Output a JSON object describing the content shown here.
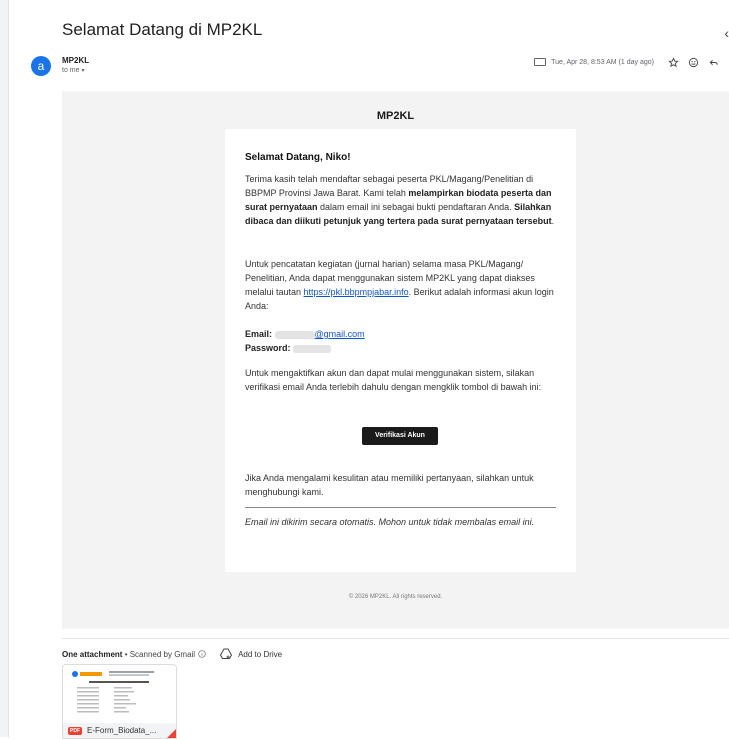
{
  "subject": "Selamat Datang di MP2KL",
  "sender": {
    "initial": "a",
    "name": "MP2KL",
    "to": "to me"
  },
  "meta": {
    "date": "Tue, Apr 28, 8:53 AM (1 day ago)"
  },
  "email": {
    "brand": "MP2KL",
    "greeting": "Selamat Datang, Niko!",
    "p1_a": "Terima kasih telah mendaftar sebagai peserta PKL/Magang/Penelitian di BBPMP Provinsi Jawa Barat. Kami telah ",
    "p1_b": "melampirkan biodata peserta dan surat pernyataan",
    "p1_c": " dalam email ini sebagai bukti pendaftaran Anda. ",
    "p1_d": "Silahkan dibaca dan diikuti petunjuk yang tertera pada surat pernyataan tersebut",
    "p1_e": ".",
    "p2_a": "Untuk pencatatan kegiatan (jurnal harian) selama masa PKL/Magang/ Penelitian, Anda dapat menggunakan sistem MP2KL yang dapat diakses melalui tautan ",
    "p2_link": "https://pkl.bbpmpjabar.info",
    "p2_b": ". Berikut adalah informasi akun login Anda:",
    "email_label": "Email:",
    "email_value": "@gmail.com",
    "password_label": "Password:",
    "p3": "Untuk mengaktifkan akun dan dapat mulai menggunakan sistem, silakan verifikasi email Anda terlebih dahulu dengan mengklik tombol di bawah ini:",
    "button": "Verifikasi Akun",
    "p4": "Jika Anda mengalami kesulitan atau memiliki pertanyaan, silahkan untuk menghubungi kami.",
    "p5": "Email ini dikirim secara otomatis. Mohon untuk tidak membalas email ini.",
    "footer": "© 2026 MP2KL. All rights reserved."
  },
  "attachments": {
    "title": "One attachment",
    "scan": "Scanned by Gmail",
    "add_drive": "Add to Drive",
    "file_badge": "PDF",
    "file_name": "E-Form_Biodata_..."
  }
}
